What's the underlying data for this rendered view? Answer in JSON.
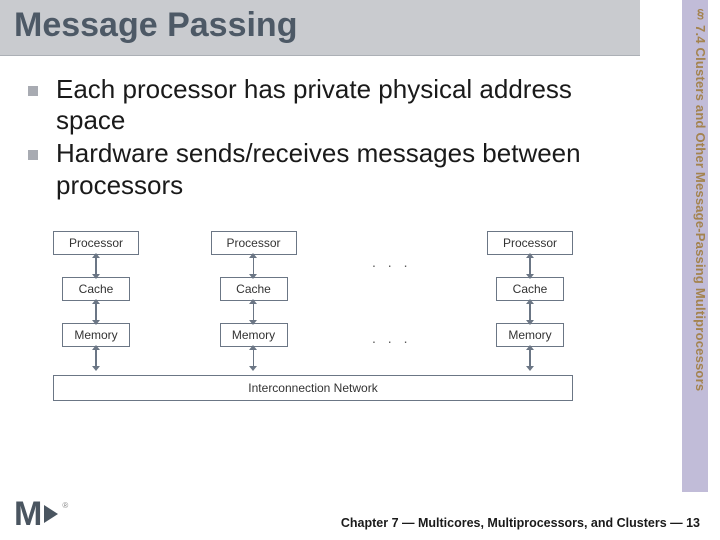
{
  "title": "Message Passing",
  "side_label": "§ 7.4 Clusters and Other Message-Passing Multiprocessors",
  "bullets": [
    "Each processor has private physical address space",
    "Hardware sends/receives messages between processors"
  ],
  "diagram": {
    "processor_label": "Processor",
    "cache_label": "Cache",
    "memory_label": "Memory",
    "ellipsis": ". . .",
    "interconnect_label": "Interconnection Network"
  },
  "footer": {
    "chapter_line": "Chapter 7 — Multicores, Multiprocessors, and Clusters — 13",
    "logo_m": "M",
    "logo_reg": "®"
  }
}
